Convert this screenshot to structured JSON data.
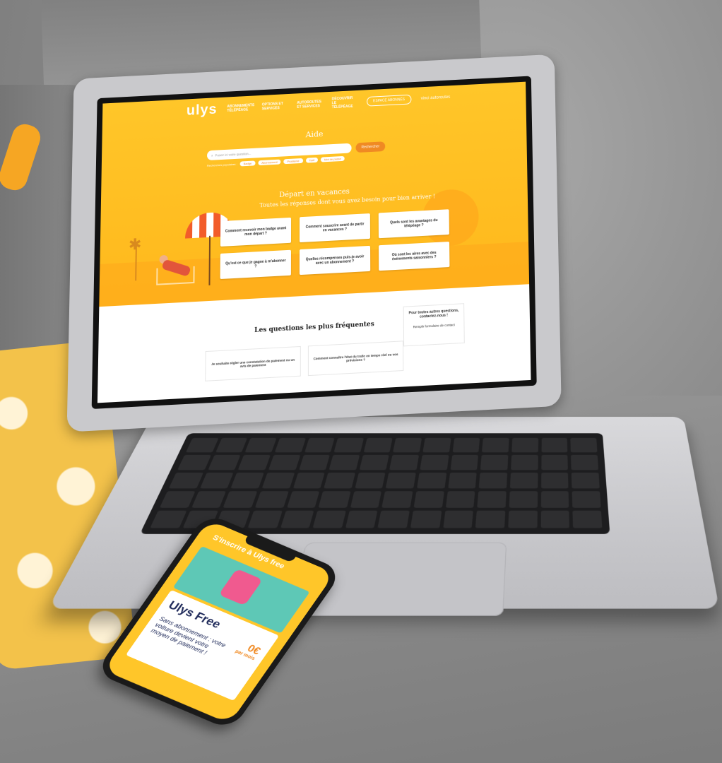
{
  "site": {
    "logo": "ulys",
    "nav": [
      "ABONNEMENTS TÉLÉPÉAGE",
      "OPTIONS ET SERVICES",
      "AUTOROUTES ET SERVICES",
      "DÉCOUVRIR LE TÉLÉPÉAGE"
    ],
    "account_button": "ESPACE ABONNÉS",
    "partner_logo": "vinci autoroutes"
  },
  "help": {
    "title": "Aide",
    "search_placeholder": "Posez ici votre question...",
    "search_button": "Rechercher",
    "popular_label": "Recherches populaires :",
    "chips": [
      "Badge",
      "Abonnement",
      "Problème",
      "Tarif",
      "Mot de passe"
    ]
  },
  "promo": {
    "title": "Départ en vacances",
    "subtitle": "Toutes les réponses dont vous avez besoin pour bien arriver !",
    "questions": [
      "Comment recevoir mon badge avant mon départ ?",
      "Comment souscrire avant de partir en vacances ?",
      "Quels sont les avantages du télépéage ?",
      "Qu'est ce que je gagne à m'abonner ?",
      "Quelles récompenses puis-je avoir avec un abonnement ?",
      "Où sont les aires avec des événements saisonniers ?"
    ]
  },
  "faq": {
    "title": "Les questions les plus fréquentes",
    "items": [
      "Je souhaite régler une constatation de paiement ou un avis de paiement",
      "Comment connaître l'état du trafic en temps réel ou vos prévisions ?"
    ],
    "contact_title": "Pour toutes autres questions, contactez-nous !",
    "contact_link": "Remplir formulaire de contact"
  },
  "phone": {
    "header": "S'inscrire à Ulys free",
    "card_title": "Ulys Free",
    "card_desc": "Sans abonnement : votre voiture devient votre moyen de paiement !",
    "price": "0€",
    "price_unit": "par mois"
  },
  "colors": {
    "brand_yellow": "#ffc629",
    "accent_orange": "#f08a23"
  }
}
